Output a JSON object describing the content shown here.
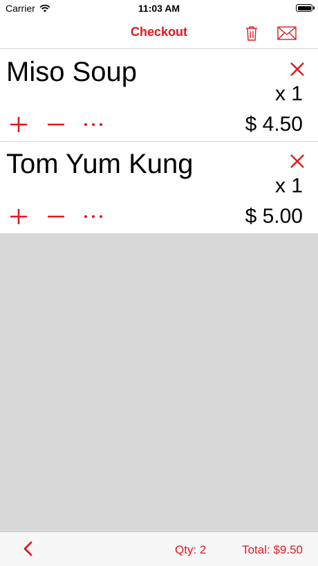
{
  "status_bar": {
    "carrier": "Carrier",
    "time": "11:03 AM"
  },
  "nav": {
    "title": "Checkout",
    "trash_icon": "trash-icon",
    "mail_icon": "mail-icon"
  },
  "items": [
    {
      "name": "Miso Soup",
      "quantity": "x 1",
      "price": "$ 4.50"
    },
    {
      "name": "Tom Yum Kung",
      "quantity": "x 1",
      "price": "$ 5.00"
    }
  ],
  "toolbar": {
    "qty": "Qty: 2",
    "total": "Total: $9.50"
  },
  "colors": {
    "accent": "#e3171b",
    "empty_area": "#d8d8d8"
  }
}
